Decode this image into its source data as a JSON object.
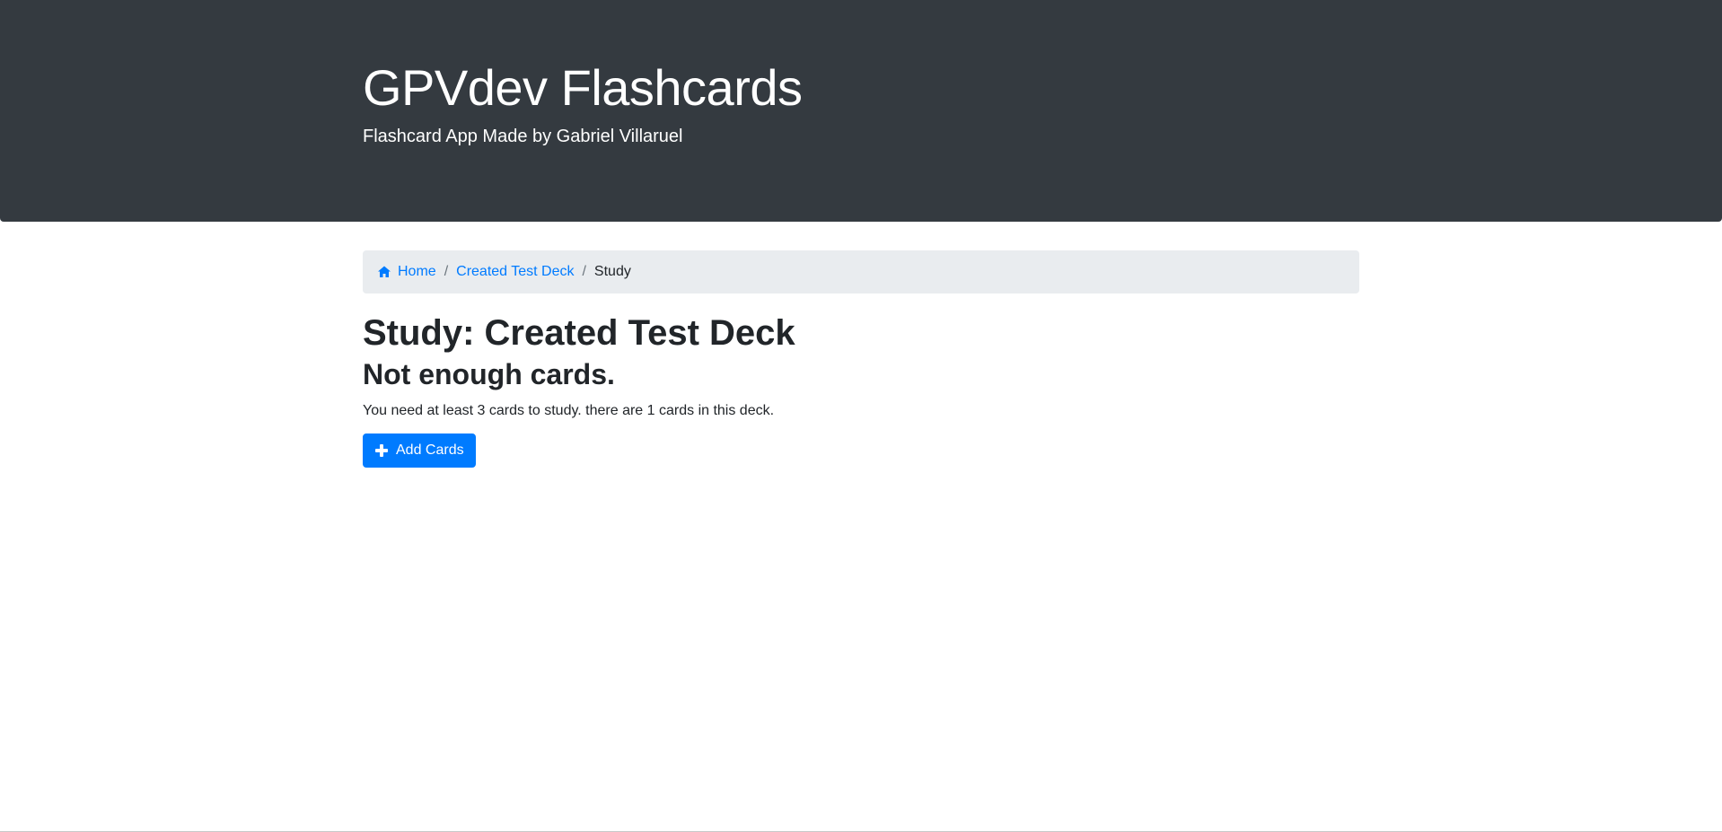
{
  "header": {
    "title": "GPVdev Flashcards",
    "subtitle": "Flashcard App Made by Gabriel Villaruel"
  },
  "breadcrumb": {
    "home_label": "Home",
    "deck_label": "Created Test Deck",
    "current_label": "Study",
    "separator": "/"
  },
  "main": {
    "heading": "Study: Created Test Deck",
    "subheading": "Not enough cards.",
    "message": "You need at least 3 cards to study. there are 1 cards in this deck.",
    "add_button_label": "Add Cards"
  },
  "colors": {
    "header_bg": "#343a40",
    "accent": "#007bff",
    "breadcrumb_bg": "#e9ecef"
  },
  "icons": {
    "home": "home-icon",
    "plus": "plus-icon"
  }
}
